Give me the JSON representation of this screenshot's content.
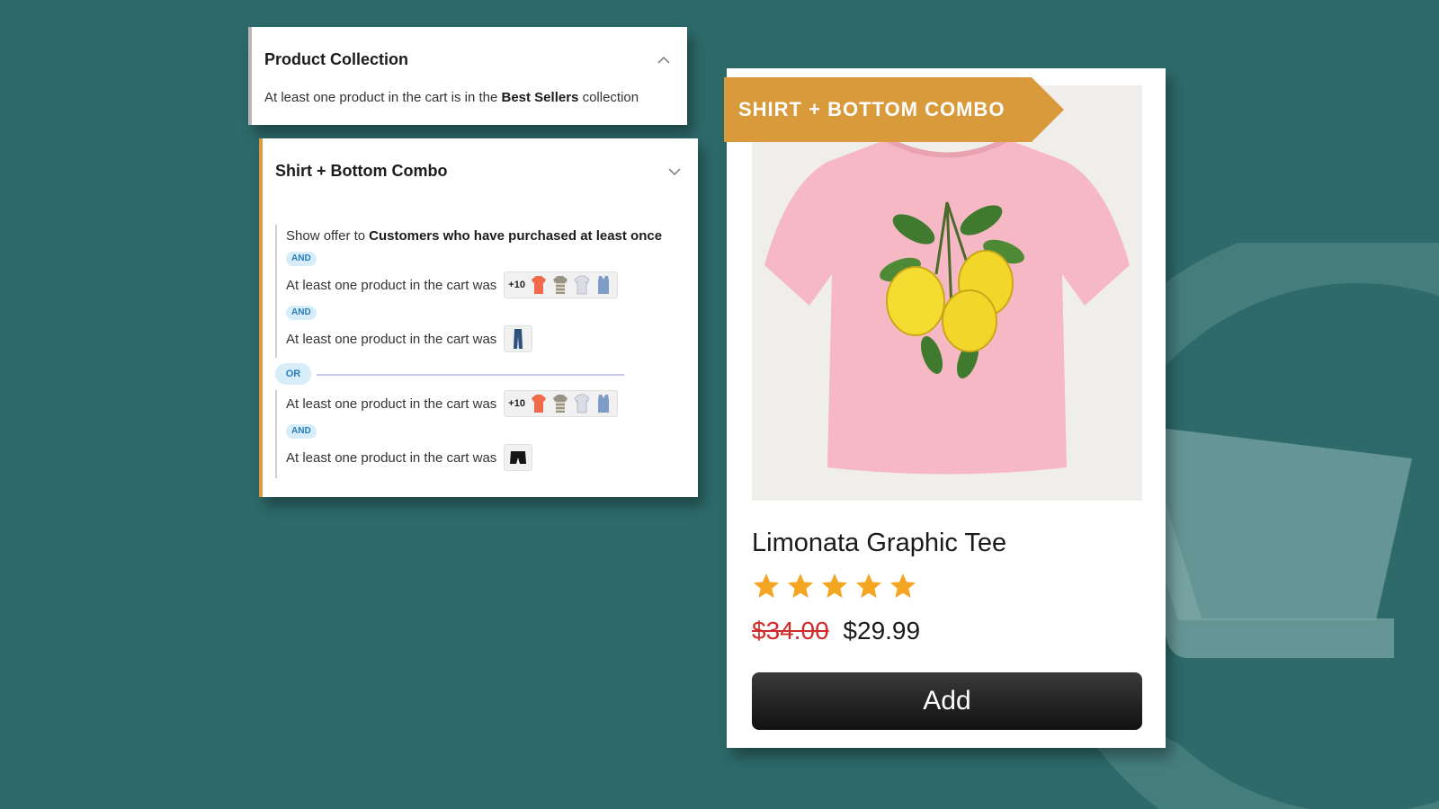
{
  "colors": {
    "background": "#2e6a6a",
    "ribbon": "#d89a3a",
    "badge_bg": "#d7eefa",
    "badge_text": "#2a7bb8",
    "old_price": "#d22b2b",
    "star": "#f4a623",
    "button": "#1a1a1a"
  },
  "collection_panel": {
    "title": "Product Collection",
    "chevron_icon": "chevron-up-icon",
    "desc_prefix": "At least one product in the cart is in the",
    "desc_bold": "Best Sellers",
    "desc_suffix": "collection"
  },
  "combo_panel": {
    "title": "Shirt + Bottom Combo",
    "chevron_icon": "chevron-down-icon",
    "show_offer_prefix": "Show offer to",
    "show_offer_bold": "Customers who have purchased at least once",
    "and_label": "AND",
    "or_label": "OR",
    "rule_text": "At least one product in the cart was",
    "more_count": "+10",
    "thumb_icons": [
      "orange-shirt-icon",
      "striped-shirt-icon",
      "white-shirt-icon",
      "blue-tank-icon"
    ],
    "bottom_icons": [
      "jeans-icon",
      "shorts-icon"
    ]
  },
  "product": {
    "ribbon": "SHIRT + BOTTOM COMBO",
    "image_icon": "pink-lemon-tshirt-image",
    "name": "Limonata Graphic Tee",
    "rating": 5,
    "rating_max": 5,
    "old_price": "$34.00",
    "new_price": "$29.99",
    "add_label": "Add"
  }
}
